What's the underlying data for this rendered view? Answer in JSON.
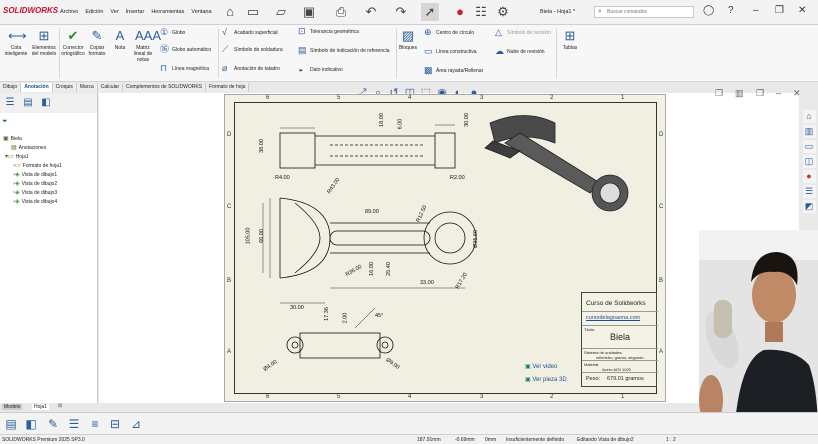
{
  "app": {
    "logo": "SOLIDWORKS",
    "menu": [
      "Archivo",
      "Edición",
      "Ver",
      "Insertar",
      "Herramientas",
      "Ventana"
    ],
    "doc_title": "Biela - Hoja1 *",
    "search_placeholder": "Buscar comandos"
  },
  "ribbon": {
    "big": [
      {
        "label": "Cota inteligente",
        "icon": "smart-dimension-icon"
      },
      {
        "label": "Elementos del modelo",
        "icon": "model-items-icon"
      },
      {
        "label": "Corrector ortográfico",
        "icon": "spell-checker-icon"
      },
      {
        "label": "Copiar formato",
        "icon": "format-painter-icon"
      },
      {
        "label": "Nota",
        "icon": "note-icon"
      },
      {
        "label": "Matriz lineal de notas",
        "icon": "linear-note-pattern-icon"
      },
      {
        "label": "Bloques",
        "icon": "blocks-icon"
      },
      {
        "label": "Tablas",
        "icon": "tables-icon"
      }
    ],
    "small": [
      "Globo",
      "Globo automático",
      "Línea magnética",
      "Acabado superficial",
      "Símbolo de soldadura",
      "Anotación de taladro",
      "Tolerancia geométrica",
      "Símbolo de indicación de referencia",
      "Dato indicativo",
      "Centro de círculo",
      "Símbolo de revisión",
      "Línea constructiva",
      "Nube de revisión",
      "Área rayada/Rellenar"
    ]
  },
  "tabs": [
    "Dibujo",
    "Anotación",
    "Croquis",
    "Marca",
    "Calcular",
    "Complementos de SOLIDWORKS",
    "Formato de hoja"
  ],
  "active_tab": "Anotación",
  "tree": {
    "root": "Biela",
    "items": [
      "Anotaciones",
      "Hoja1",
      "Formato de hoja1",
      "Vista de dibujo1",
      "Vista de dibujo2",
      "Vista de dibujo3",
      "Vista de dibujo4"
    ]
  },
  "zones": {
    "cols": [
      "6",
      "5",
      "4",
      "3",
      "2",
      "1"
    ],
    "rows": [
      "D",
      "C",
      "B",
      "A"
    ]
  },
  "dims": [
    "38.00",
    "18.00",
    "6.00",
    "30.00",
    "R4.00",
    "R2.00",
    "R43.00",
    "89.00",
    "R12.50",
    "105.00",
    "66.00",
    "Ø35.60",
    "R36.00",
    "16.00",
    "25.40",
    "33.00",
    "R17.20",
    "30.00",
    "17.36",
    "2.00",
    "45°",
    "Ø4.00",
    "Ø9.00"
  ],
  "title_block": {
    "company": "Curso de Solidworks",
    "url": "cursodelagoaona.com",
    "title_label": "Título:",
    "title": "Biela",
    "units_label": "Sistema de unidades:",
    "units": "milímetro, gramo, segundo",
    "material_label": "Material:",
    "material": "Acero AISI 1020",
    "weight_label": "Peso:",
    "weight": "679.01 gramos"
  },
  "links": {
    "video": "Ver video",
    "piece3d": "Ver pieza 3D"
  },
  "sheet_tabs": [
    "Modelo",
    "Hoja1"
  ],
  "status": {
    "product": "SOLIDWORKS Premium 2025 SP3.0",
    "x": "187.91mm",
    "y": "-0.69mm",
    "z": "0mm",
    "state": "Insuficientemente definido",
    "editing": "Editando Vista de dibujo2",
    "scale": "1 : 2"
  }
}
